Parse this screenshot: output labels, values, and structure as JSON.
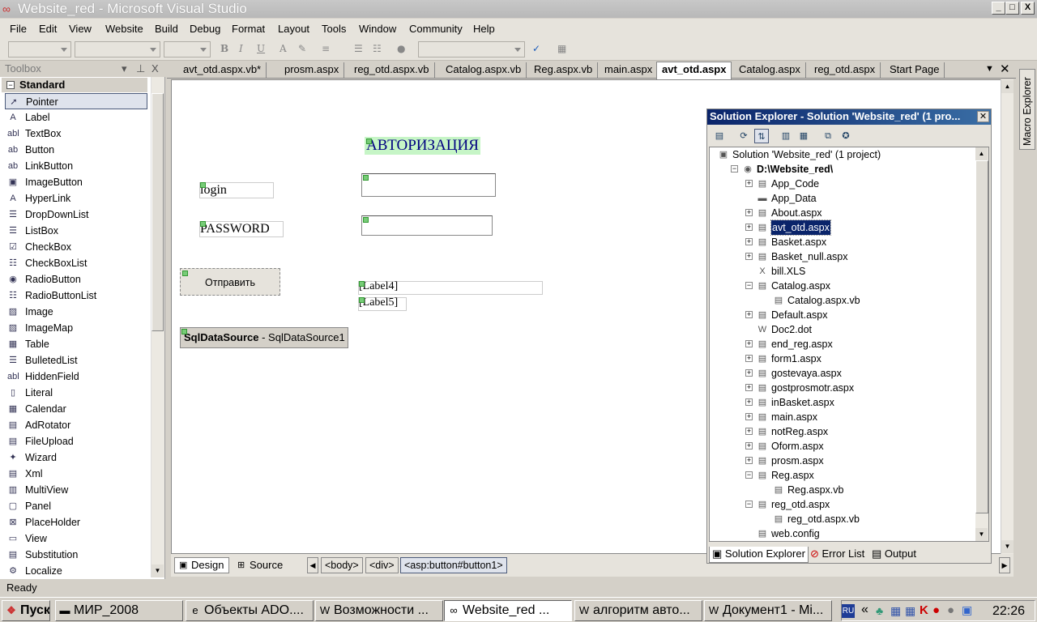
{
  "window": {
    "title": "Website_red - Microsoft Visual Studio",
    "buttons": [
      "_",
      "□",
      "X"
    ]
  },
  "menu": [
    "File",
    "Edit",
    "View",
    "Website",
    "Build",
    "Debug",
    "Format",
    "Layout",
    "Tools",
    "Window",
    "Community",
    "Help"
  ],
  "toolbar": {
    "bold": "B",
    "italic": "I",
    "underline": "U"
  },
  "toolbox": {
    "title": "Toolbox",
    "header_buttons": [
      "▾",
      "⊥",
      "X"
    ],
    "section": "Standard",
    "items": [
      {
        "label": "Pointer",
        "icon": "➚"
      },
      {
        "label": "Label",
        "icon": "A"
      },
      {
        "label": "TextBox",
        "icon": "abl"
      },
      {
        "label": "Button",
        "icon": "ab"
      },
      {
        "label": "LinkButton",
        "icon": "ab"
      },
      {
        "label": "ImageButton",
        "icon": "▣"
      },
      {
        "label": "HyperLink",
        "icon": "A"
      },
      {
        "label": "DropDownList",
        "icon": "☰"
      },
      {
        "label": "ListBox",
        "icon": "☰"
      },
      {
        "label": "CheckBox",
        "icon": "☑"
      },
      {
        "label": "CheckBoxList",
        "icon": "☷"
      },
      {
        "label": "RadioButton",
        "icon": "◉"
      },
      {
        "label": "RadioButtonList",
        "icon": "☷"
      },
      {
        "label": "Image",
        "icon": "▨"
      },
      {
        "label": "ImageMap",
        "icon": "▨"
      },
      {
        "label": "Table",
        "icon": "▦"
      },
      {
        "label": "BulletedList",
        "icon": "☰"
      },
      {
        "label": "HiddenField",
        "icon": "abl"
      },
      {
        "label": "Literal",
        "icon": "▯"
      },
      {
        "label": "Calendar",
        "icon": "▦"
      },
      {
        "label": "AdRotator",
        "icon": "▤"
      },
      {
        "label": "FileUpload",
        "icon": "▤"
      },
      {
        "label": "Wizard",
        "icon": "✦"
      },
      {
        "label": "Xml",
        "icon": "▤"
      },
      {
        "label": "MultiView",
        "icon": "▥"
      },
      {
        "label": "Panel",
        "icon": "▢"
      },
      {
        "label": "PlaceHolder",
        "icon": "⊠"
      },
      {
        "label": "View",
        "icon": "▭"
      },
      {
        "label": "Substitution",
        "icon": "▤"
      },
      {
        "label": "Localize",
        "icon": "⚙"
      }
    ]
  },
  "doc_tabs": [
    "avt_otd.aspx.vb*",
    "prosm.aspx",
    "reg_otd.aspx.vb",
    "Catalog.aspx.vb",
    "Reg.aspx.vb",
    "main.aspx",
    "avt_otd.aspx",
    "Catalog.aspx",
    "reg_otd.aspx",
    "Start Page"
  ],
  "active_doc_tab": "avt_otd.aspx",
  "designer": {
    "heading": "АВТОРИЗАЦИЯ",
    "login_label": "login",
    "password_label": "PASSWORD",
    "submit_button": "Отправить",
    "label4": "[Label4]",
    "label5": "[Label5]",
    "sqlds_type": "SqlDataSource",
    "sqlds_name": " - SqlDataSource1"
  },
  "view_bar": {
    "design": "Design",
    "source": "Source",
    "crumbs": [
      "<body>",
      "<div>",
      "<asp:button#button1>"
    ]
  },
  "solution_explorer": {
    "title": "Solution Explorer - Solution 'Website_red' (1 pro...",
    "nodes": [
      {
        "name": "Solution 'Website_red' (1 project)",
        "level": 0,
        "expander": "",
        "icon": "▣"
      },
      {
        "name": "D:\\Website_red\\",
        "level": 1,
        "expander": "−",
        "icon": "◉",
        "bold": true
      },
      {
        "name": "App_Code",
        "level": 2,
        "expander": "+",
        "icon": "▤"
      },
      {
        "name": "App_Data",
        "level": 2,
        "expander": "",
        "icon": "▬"
      },
      {
        "name": "About.aspx",
        "level": 2,
        "expander": "+",
        "icon": "▤"
      },
      {
        "name": "avt_otd.aspx",
        "level": 2,
        "expander": "+",
        "icon": "▤",
        "selected": true
      },
      {
        "name": "Basket.aspx",
        "level": 2,
        "expander": "+",
        "icon": "▤"
      },
      {
        "name": "Basket_null.aspx",
        "level": 2,
        "expander": "+",
        "icon": "▤"
      },
      {
        "name": "bill.XLS",
        "level": 2,
        "expander": "",
        "icon": "X"
      },
      {
        "name": "Catalog.aspx",
        "level": 2,
        "expander": "−",
        "icon": "▤"
      },
      {
        "name": "Catalog.aspx.vb",
        "level": 3,
        "expander": "",
        "icon": "▤"
      },
      {
        "name": "Default.aspx",
        "level": 2,
        "expander": "+",
        "icon": "▤"
      },
      {
        "name": "Doc2.dot",
        "level": 2,
        "expander": "",
        "icon": "W"
      },
      {
        "name": "end_reg.aspx",
        "level": 2,
        "expander": "+",
        "icon": "▤"
      },
      {
        "name": "form1.aspx",
        "level": 2,
        "expander": "+",
        "icon": "▤"
      },
      {
        "name": "gostevaya.aspx",
        "level": 2,
        "expander": "+",
        "icon": "▤"
      },
      {
        "name": "gostprosmotr.aspx",
        "level": 2,
        "expander": "+",
        "icon": "▤"
      },
      {
        "name": "inBasket.aspx",
        "level": 2,
        "expander": "+",
        "icon": "▤"
      },
      {
        "name": "main.aspx",
        "level": 2,
        "expander": "+",
        "icon": "▤"
      },
      {
        "name": "notReg.aspx",
        "level": 2,
        "expander": "+",
        "icon": "▤"
      },
      {
        "name": "Oform.aspx",
        "level": 2,
        "expander": "+",
        "icon": "▤"
      },
      {
        "name": "prosm.aspx",
        "level": 2,
        "expander": "+",
        "icon": "▤"
      },
      {
        "name": "Reg.aspx",
        "level": 2,
        "expander": "−",
        "icon": "▤"
      },
      {
        "name": "Reg.aspx.vb",
        "level": 3,
        "expander": "",
        "icon": "▤"
      },
      {
        "name": "reg_otd.aspx",
        "level": 2,
        "expander": "−",
        "icon": "▤"
      },
      {
        "name": "reg_otd.aspx.vb",
        "level": 3,
        "expander": "",
        "icon": "▤"
      },
      {
        "name": "web.config",
        "level": 2,
        "expander": "",
        "icon": "▤"
      }
    ],
    "tabs": [
      "Solution Explorer",
      "Error List",
      "Output"
    ]
  },
  "macro_explorer": "Macro Explorer",
  "status": "Ready",
  "taskbar": {
    "start": "Пуск",
    "tasks": [
      {
        "label": "МИР_2008",
        "icon": "▬"
      },
      {
        "label": "Объекты ADO....",
        "icon": "e"
      },
      {
        "label": "Возможности ...",
        "icon": "W"
      },
      {
        "label": "Website_red ...",
        "icon": "∞",
        "active": true
      },
      {
        "label": "алгоритм авто...",
        "icon": "W"
      },
      {
        "label": "Документ1 - Mi...",
        "icon": "W"
      }
    ],
    "lang": "RU",
    "clock": "22:26"
  }
}
